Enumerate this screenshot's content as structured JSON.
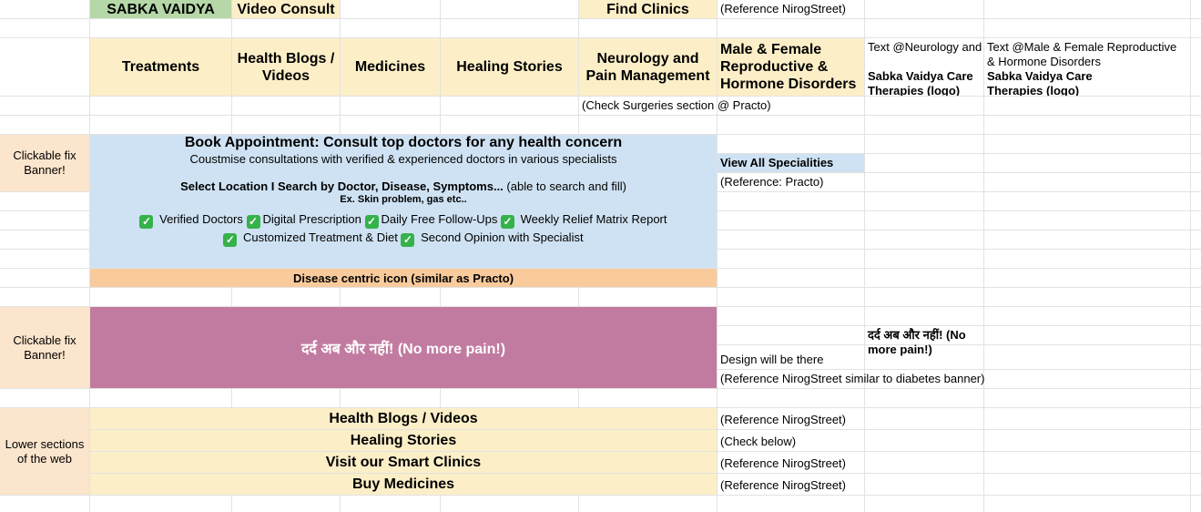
{
  "row1": {
    "sabka_vaidya": "SABKA VAIDYA",
    "video_consult": "Video Consult",
    "find_clinics": "Find Clinics",
    "ref": "(Reference NirogStreet)"
  },
  "row2": {
    "treatments": "Treatments",
    "health_blogs_line1": "Health Blogs /",
    "health_blogs_line2": "Videos",
    "medicines": "Medicines",
    "healing_stories": "Healing Stories",
    "neuro_line1": "Neurology and",
    "neuro_line2": "Pain Management",
    "mf_line1": "Male & Female",
    "mf_line2": "Reproductive &",
    "mf_line3": "Hormone Disorders",
    "text_neuro": "Text @Neurology and",
    "text_mf_line1": "Text @Male & Female Reproductive",
    "text_mf_line2": "& Hormone Disorders",
    "care_neuro_line1": "Sabka Vaidya Care",
    "care_neuro_line2": "Therapies (logo)",
    "care_mf_line1": "Sabka Vaidya Care",
    "care_mf_line2": "Therapies (logo)"
  },
  "row3": {
    "note": "(Check Surgeries section @ Practo)"
  },
  "banner1": {
    "side_line1": "Clickable fix",
    "side_line2": "Banner!",
    "title": "Book Appointment: Consult top doctors for any health concern",
    "subtitle": "Coustmise consultations with verified & experienced doctors in various specialists",
    "select_bold": "Select Location  I  Search by Doctor, Disease, Symptoms...",
    "select_rest": " (able to search and fill)",
    "example": "Ex. Skin problem, gas etc..",
    "features_row1": [
      "Verified Doctors",
      "Digital Prescription",
      "Daily Free Follow-Ups",
      "Weekly Relief Matrix Report"
    ],
    "features_row2": [
      "Customized Treatment & Diet",
      "Second Opinion with Specialist"
    ],
    "view_all": "View All Specialities",
    "view_all_ref": "(Reference: Practo)",
    "disease_icon": "Disease centric icon (similar as Practo)"
  },
  "banner2": {
    "side_line1": "Clickable fix",
    "side_line2": "Banner!",
    "text": "दर्द अब और नहीं!  (No more pain!)",
    "right_text_line1": "दर्द अब और नहीं!  (No",
    "right_text_line2": "more pain!)",
    "design_note": "Design will be there",
    "ref": "(Reference NirogStreet similar to diabetes banner)"
  },
  "lower": {
    "side_line1": "Lower sections",
    "side_line2": "of the web",
    "rows": [
      {
        "label": "Health Blogs / Videos",
        "ref": "(Reference NirogStreet)"
      },
      {
        "label": "Healing Stories",
        "ref": "(Check below)"
      },
      {
        "label": "Visit our Smart Clinics",
        "ref": "(Reference NirogStreet)"
      },
      {
        "label": "Buy Medicines",
        "ref": "(Reference NirogStreet)"
      }
    ]
  },
  "colors": {
    "header_bg": "#fcefc8",
    "green_cell": "#b6d7a8",
    "side_bg": "#fce5cd",
    "banner_blue": "#cfe2f3",
    "orange_bar": "#f9cb9c",
    "banner_pink": "#c27ba0",
    "check_green": "#35b24a"
  }
}
